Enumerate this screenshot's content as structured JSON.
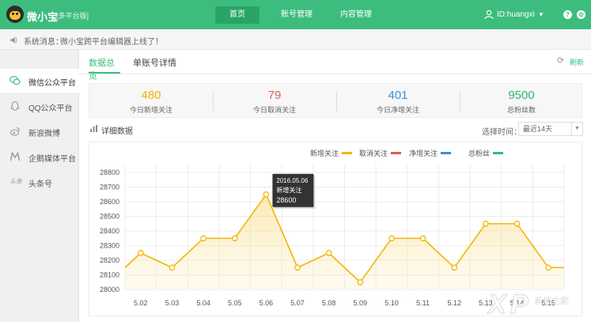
{
  "header": {
    "brand": "微小宝",
    "brand_sub": "[多平台版]",
    "nav": [
      {
        "label": "首页",
        "active": true
      },
      {
        "label": "账号管理",
        "active": false
      },
      {
        "label": "内容管理",
        "active": false
      }
    ],
    "user_id": "ID:huangxi",
    "help_icon": "?",
    "gear_icon": "✿"
  },
  "notice": {
    "label": "系统消息：",
    "message": "微小宝跨平台编辑器上线了！"
  },
  "sidebar": {
    "items": [
      {
        "label": "微信公众平台",
        "icon": "wechat-icon",
        "active": true
      },
      {
        "label": "QQ公众平台",
        "icon": "qq-icon",
        "active": false
      },
      {
        "label": "新浪微博",
        "icon": "weibo-icon",
        "active": false
      },
      {
        "label": "企鹅媒体平台",
        "icon": "penguin-media-icon",
        "active": false
      },
      {
        "label": "头条号",
        "icon": "toutiao-icon",
        "active": false
      }
    ]
  },
  "main": {
    "tabs": [
      {
        "label": "数据总览",
        "active": true
      },
      {
        "label": "单账号详情",
        "active": false
      }
    ],
    "refresh_label": "刷新",
    "stats": [
      {
        "value": "480",
        "caption": "今日新增关注",
        "color": "#f0b400"
      },
      {
        "value": "79",
        "caption": "今日取消关注",
        "color": "#e55f5f"
      },
      {
        "value": "401",
        "caption": "今日净增关注",
        "color": "#3a8ed6"
      },
      {
        "value": "9500",
        "caption": "总粉丝数",
        "color": "#2bb673"
      }
    ],
    "detail_title": "详细数据",
    "time_label": "选择时间：",
    "time_value": "最近14天"
  },
  "tooltip": {
    "date": "2016.05.06",
    "label": "新增关注",
    "value": "28600"
  },
  "chart_data": {
    "type": "line",
    "x": [
      "5.02",
      "5.03",
      "5.04",
      "5.05",
      "5.06",
      "5.07",
      "5.08",
      "5.09",
      "5.10",
      "5.11",
      "5.12",
      "5.13",
      "5.14",
      "5.15"
    ],
    "series": [
      {
        "name": "新增关注",
        "color": "#f2b705",
        "values": [
          28250,
          28150,
          28350,
          28350,
          28650,
          28150,
          28250,
          28050,
          28350,
          28350,
          28150,
          28450,
          28450,
          28150
        ]
      }
    ],
    "legend": [
      {
        "name": "新增关注",
        "color": "#f2b705"
      },
      {
        "name": "取消关注",
        "color": "#e05a5a"
      },
      {
        "name": "净增关注",
        "color": "#3a8ed6"
      },
      {
        "name": "总粉丝",
        "color": "#2bc27a"
      }
    ],
    "y_ticks": [
      "28800",
      "28700",
      "28600",
      "28500",
      "28400",
      "28300",
      "28200",
      "28100",
      "28000"
    ],
    "ylim": [
      28000,
      28800
    ],
    "x_edge_values": {
      "left": 28150,
      "right": 28150
    },
    "grid": true,
    "legend_position": "top-center"
  }
}
